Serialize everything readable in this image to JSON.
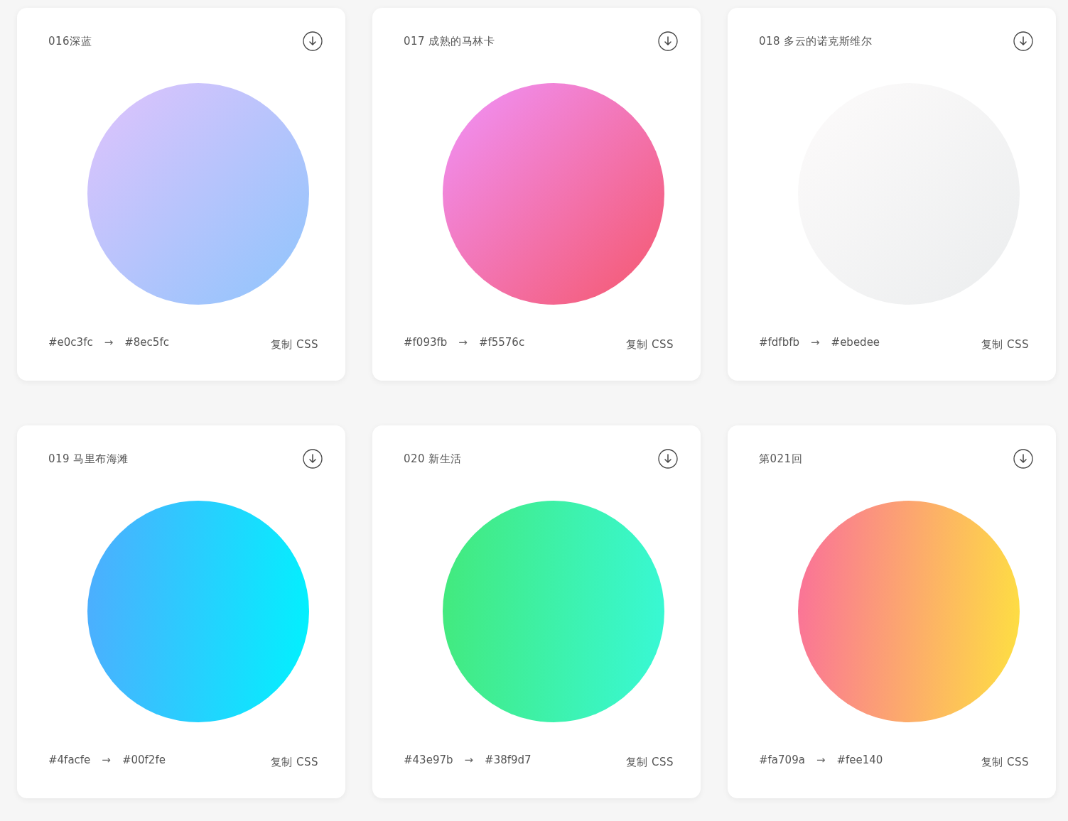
{
  "cards": [
    {
      "title": "016深蓝",
      "from": "#e0c3fc",
      "arrow": "→",
      "to": "#8ec5fc",
      "kind": "diagonal",
      "copy": "复制 CSS"
    },
    {
      "title": "017 成熟的马林卡",
      "from": "#f093fb",
      "arrow": "→",
      "to": "#f5576c",
      "kind": "diagonal",
      "copy": "复制 CSS"
    },
    {
      "title": "018 多云的诺克斯维尔",
      "from": "#fdfbfb",
      "arrow": "→",
      "to": "#ebedee",
      "kind": "diagonal",
      "copy": "复制 CSS"
    },
    {
      "title": "019 马里布海滩",
      "from": "#4facfe",
      "arrow": "→",
      "to": "#00f2fe",
      "kind": "horizontal",
      "copy": "复制 CSS"
    },
    {
      "title": "020 新生活",
      "from": "#43e97b",
      "arrow": "→",
      "to": "#38f9d7",
      "kind": "horizontal",
      "copy": "复制 CSS"
    },
    {
      "title": "第021回",
      "from": "#fa709a",
      "arrow": "→",
      "to": "#fee140",
      "kind": "horizontal",
      "copy": "复制 CSS"
    }
  ]
}
